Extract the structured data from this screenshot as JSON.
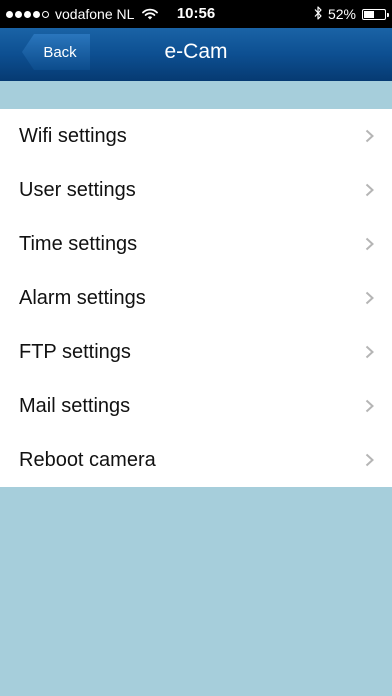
{
  "status_bar": {
    "carrier": "vodafone NL",
    "time": "10:56",
    "battery": "52%",
    "battery_level": 0.52,
    "signal_bars_filled": 4,
    "signal_bars_total": 5
  },
  "nav": {
    "back_label": "Back",
    "title": "e-Cam"
  },
  "settings": {
    "items": [
      {
        "label": "Wifi settings"
      },
      {
        "label": "User settings"
      },
      {
        "label": "Time settings"
      },
      {
        "label": "Alarm settings"
      },
      {
        "label": "FTP settings"
      },
      {
        "label": "Mail settings"
      },
      {
        "label": "Reboot camera"
      }
    ]
  },
  "colors": {
    "background": "#a6cedb",
    "nav_bar": "#0d4f91",
    "chevron": "#b5b5b5"
  },
  "icons": {
    "wifi": "wifi-icon",
    "bluetooth": "bluetooth-icon",
    "chevron": "chevron-right-icon"
  }
}
